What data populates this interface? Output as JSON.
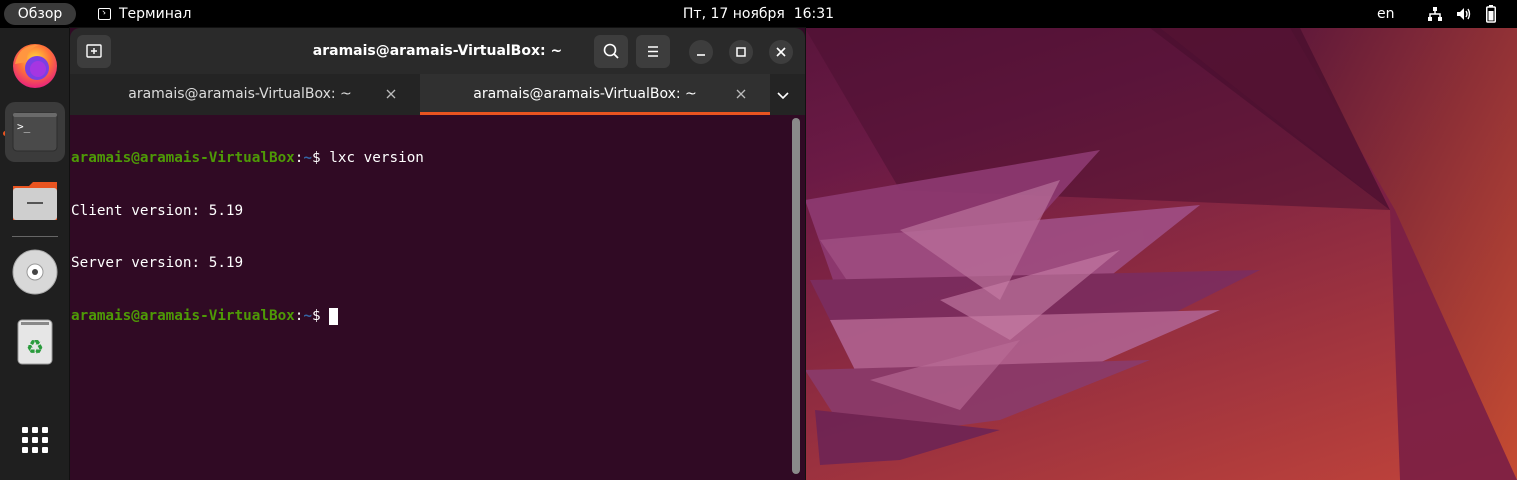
{
  "topbar": {
    "overview_label": "Обзор",
    "app_name": "Терминал",
    "clock": "Пт, 17 ноября  16:31",
    "language": "en",
    "tray_icons": [
      "network-icon",
      "volume-icon",
      "battery-icon"
    ]
  },
  "dock": {
    "items": [
      "firefox-icon",
      "terminal-icon",
      "files-icon",
      "dvd-drive-icon",
      "trash-icon",
      "show-apps-icon"
    ],
    "active_item": "terminal-icon"
  },
  "terminal": {
    "title": "aramais@aramais-VirtualBox: ~",
    "tabs": [
      {
        "label": "aramais@aramais-VirtualBox: ~",
        "active": false
      },
      {
        "label": "aramais@aramais-VirtualBox: ~",
        "active": true
      }
    ],
    "prompt_user": "aramais@aramais-VirtualBox",
    "prompt_sep": ":",
    "prompt_path": "~",
    "prompt_symbol": "$ ",
    "command": "lxc version",
    "output": [
      "Client version: 5.19",
      "Server version: 5.19"
    ]
  },
  "colors": {
    "terminal_bg": "#300a24",
    "prompt_user": "#4e9a06",
    "prompt_path": "#3465a4",
    "accent": "#e95420"
  }
}
